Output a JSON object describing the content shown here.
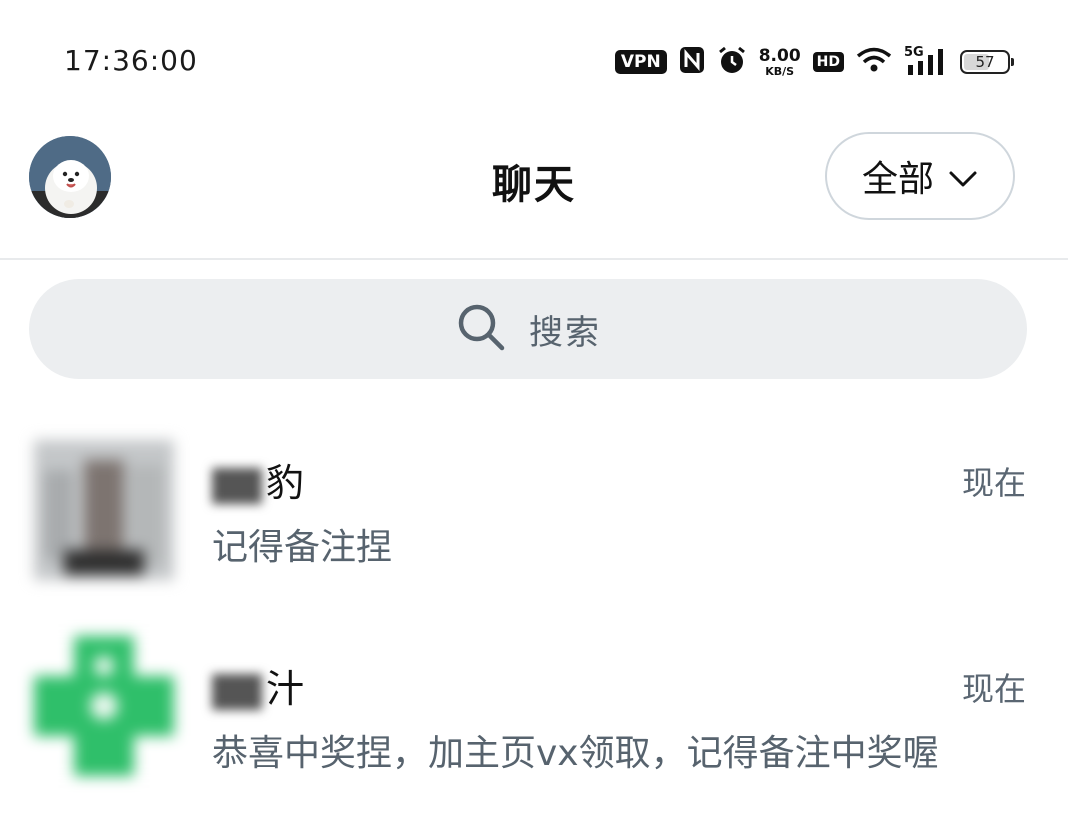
{
  "status_bar": {
    "time": "17:36:00",
    "vpn_label": "VPN",
    "speed_value": "8.00",
    "speed_unit": "KB/S",
    "hd_label": "HD",
    "network_label": "5G",
    "battery_level": "57"
  },
  "header": {
    "title": "聊天",
    "filter_label": "全部"
  },
  "search": {
    "placeholder": "搜索"
  },
  "chats": [
    {
      "name_suffix": "豹",
      "time": "现在",
      "preview": "记得备注捏",
      "avatar_color": "#b9bcbf"
    },
    {
      "name_suffix": "汁",
      "time": "现在",
      "preview": "恭喜中奖捏，加主页vx领取，记得备注中奖喔",
      "avatar_color": "#2fbf6a"
    }
  ],
  "colors": {
    "accent_text": "#57636e",
    "search_bg": "#eceef0",
    "divider": "#e8eaec"
  }
}
